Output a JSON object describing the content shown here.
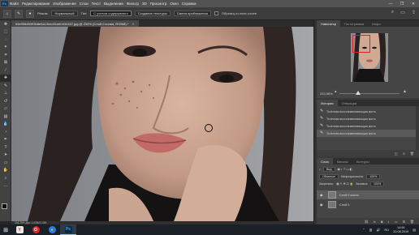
{
  "app": {
    "logo": "Ps"
  },
  "menu": [
    "Файл",
    "Редактирование",
    "Изображение",
    "Слои",
    "Текст",
    "Выделение",
    "Фильтр",
    "3D",
    "Просмотр",
    "Окно",
    "Справка"
  ],
  "window_controls": [
    "—",
    "❐",
    "✕"
  ],
  "options": {
    "mode_label": "Режим:",
    "mode_value": "Нормальный",
    "type_label": "Тип:",
    "type_active": "С учетом содержимого",
    "type_texture": "Создание текстуры",
    "type_approx": "Смена приближения",
    "sample_all": "Образец со всех слоев"
  },
  "document": {
    "tab_title": "69e99845393b8e9a13eec51e60434167.jpg @ 234% (Слой 0 копия, RGB/8) *",
    "status": "234,25%   Док: 1,02M/2,10M"
  },
  "navigator": {
    "tabs": [
      "Навигатор",
      "Гистограмма",
      "Инфо"
    ],
    "zoom": "233,96%"
  },
  "history": {
    "tabs": [
      "История",
      "Операции"
    ],
    "items": [
      "Точечная восстанавливающая кисть",
      "Точечная восстанавливающая кисть",
      "Точечная восстанавливающая кисть",
      "Точечная восстанавливающая кисть"
    ]
  },
  "layers": {
    "tabs": [
      "Слои",
      "Каналы",
      "Контуры"
    ],
    "kind": "Вид",
    "blend": "Обычные",
    "opacity_label": "Непрозрачность:",
    "opacity_value": "100%",
    "lock_label": "Закрепить:",
    "fill_label": "Заливка:",
    "fill_value": "100%",
    "items": [
      {
        "name": "Слой 0 копия",
        "selected": true
      },
      {
        "name": "Слой 0",
        "selected": false
      }
    ]
  },
  "taskbar": {
    "apps": [
      {
        "name": "yandex",
        "glyph": "Y",
        "color": "#e8e8e8",
        "fg": "#e22"
      },
      {
        "name": "opera",
        "glyph": "O",
        "color": "#d9262e",
        "fg": "#fff"
      },
      {
        "name": "chrome",
        "glyph": "●",
        "color": "#2a7de1",
        "fg": "#f4c20d"
      },
      {
        "name": "photoshop",
        "glyph": "Ps",
        "color": "#0b2944",
        "fg": "#31a8ff"
      }
    ],
    "lang": "RU",
    "time": "14:54",
    "date": "20.08.2019"
  }
}
